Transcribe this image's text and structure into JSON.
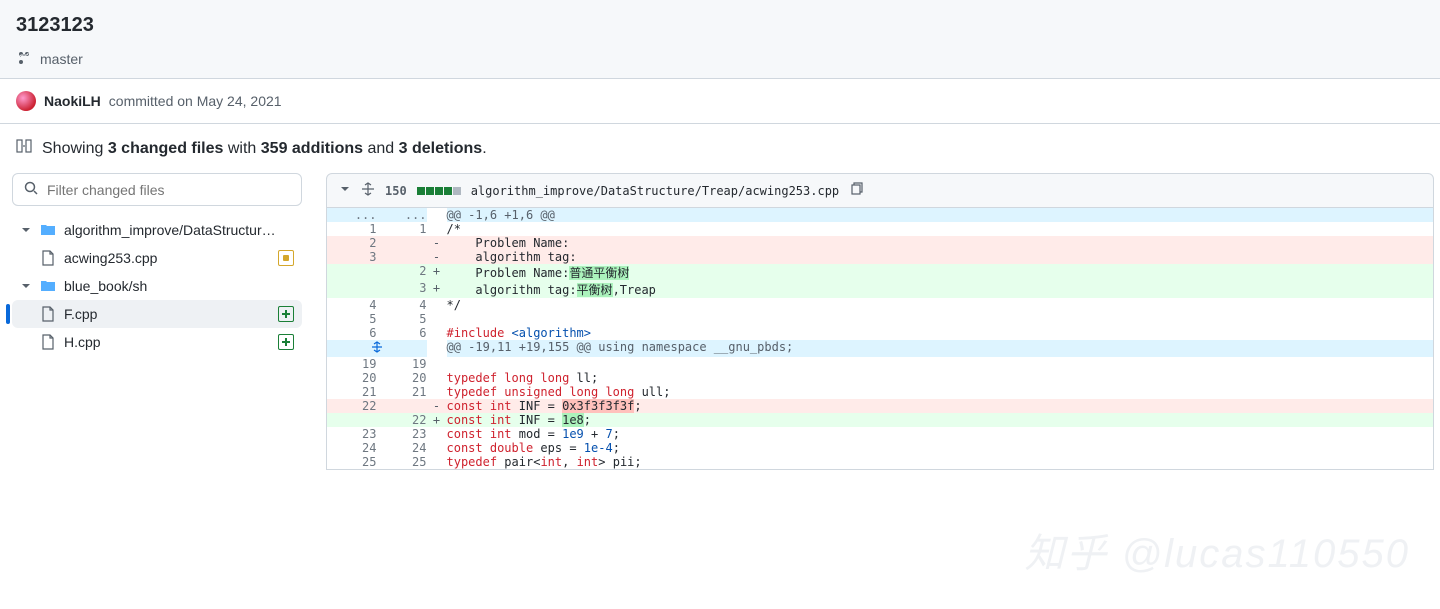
{
  "header": {
    "commit_title": "3123123",
    "branch": "master"
  },
  "meta": {
    "author": "NaokiLH",
    "action_text": "committed on May 24, 2021"
  },
  "summary": {
    "prefix": "Showing ",
    "files_bold": "3 changed files",
    "mid1": " with ",
    "adds_bold": "359 additions",
    "mid2": " and ",
    "dels_bold": "3 deletions",
    "suffix": "."
  },
  "filter": {
    "placeholder": "Filter changed files"
  },
  "tree": {
    "folder1": "algorithm_improve/DataStructur…",
    "file1": "acwing253.cpp",
    "folder2": "blue_book/sh",
    "file2": "F.cpp",
    "file3": "H.cpp"
  },
  "filehdr": {
    "count": "150",
    "path": "algorithm_improve/DataStructure/Treap/acwing253.cpp"
  },
  "hunks": {
    "h1": "@@ -1,6 +1,6 @@",
    "h2": "@@ -19,11 +19,155 @@ using namespace __gnu_pbds;"
  },
  "lines": {
    "l1_old": "1",
    "l1_new": "1",
    "l1_code": "/*",
    "l2_old": "2",
    "l2_code_a": "    Problem Name:",
    "l3_old": "3",
    "l3_code_a": "    algorithm tag:",
    "l4_new": "2",
    "l4_code_a": "    Problem Name:",
    "l4_hl": "普通平衡树",
    "l5_new": "3",
    "l5_code_a": "    algorithm tag:",
    "l5_hl": "平衡树",
    "l5_code_b": ",Treap",
    "l6_old": "4",
    "l6_new": "4",
    "l6_code": "*/",
    "l7_old": "5",
    "l7_new": "5",
    "l8_old": "6",
    "l8_new": "6",
    "l8_code_a": "#",
    "l8_code_b": "include",
    "l8_code_c": " <algorithm>",
    "l19_old": "19",
    "l19_new": "19",
    "l20_old": "20",
    "l20_new": "20",
    "l20_a": "typedef",
    "l20_b": " long",
    "l20_c": " long",
    "l20_d": " ll;",
    "l21_old": "21",
    "l21_new": "21",
    "l21_a": "typedef",
    "l21_b": " unsigned",
    "l21_c": " long",
    "l21_d": " long",
    "l21_e": " ull;",
    "l22d_old": "22",
    "l22d_a": "const",
    "l22d_b": " int",
    "l22d_c": " INF = ",
    "l22d_hl": "0x3f3f3f3f",
    "l22d_d": ";",
    "l22a_new": "22",
    "l22a_a": "const",
    "l22a_b": " int",
    "l22a_c": " INF = ",
    "l22a_hl": "1e8",
    "l22a_d": ";",
    "l23_old": "23",
    "l23_new": "23",
    "l23_a": "const",
    "l23_b": " int",
    "l23_c": " mod = ",
    "l23_d": "1e9",
    "l23_e": " + ",
    "l23_f": "7",
    "l23_g": ";",
    "l24_old": "24",
    "l24_new": "24",
    "l24_a": "const",
    "l24_b": " double",
    "l24_c": " eps = ",
    "l24_d": "1e-4",
    "l24_e": ";",
    "l25_old": "25",
    "l25_new": "25",
    "l25_a": "typedef",
    "l25_b": " pair<",
    "l25_c": "int",
    "l25_d": ", ",
    "l25_e": "int",
    "l25_f": "> pii;"
  },
  "watermark": "知乎  @lucas110550"
}
